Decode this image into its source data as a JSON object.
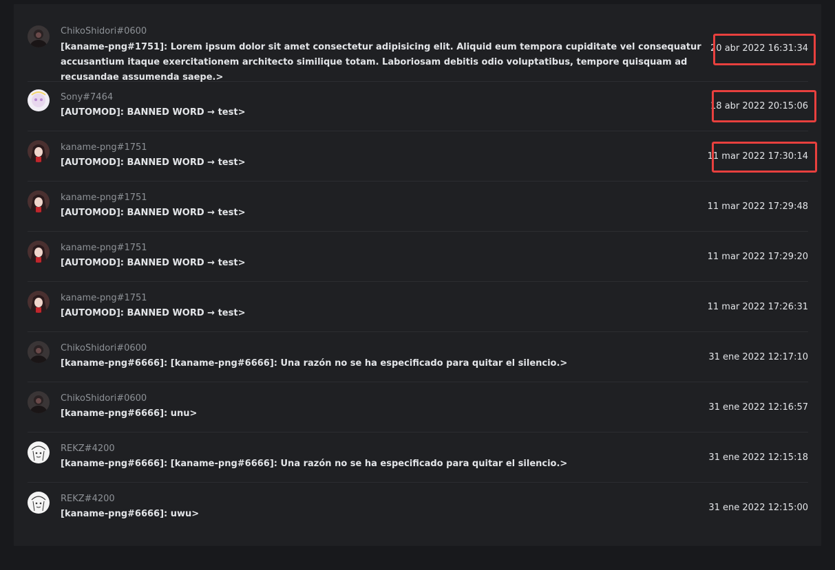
{
  "entries": [
    {
      "username": "ChikoShidori#0600",
      "message": "[kaname-png#1751]: Lorem ipsum dolor sit amet consectetur adipisicing elit. Aliquid eum tempora cupiditate vel consequatur accusantium itaque exercitationem architecto similique totam. Laboriosam debitis odio voluptatibus, tempore quisquam ad recusandae assumenda saepe.>",
      "timestamp": "20 abr 2022 16:31:34",
      "highlighted": true,
      "avatar": "dark-avatar-icon"
    },
    {
      "username": "Sony#7464",
      "message": "[AUTOMOD]: BANNED WORD → test>",
      "timestamp": "18 abr 2022 20:15:06",
      "highlighted": true,
      "avatar": "light-anime-avatar-icon"
    },
    {
      "username": "kaname-png#1751",
      "message": "[AUTOMOD]: BANNED WORD → test>",
      "timestamp": "11 mar 2022 17:30:14",
      "highlighted": true,
      "avatar": "anime-girl-avatar-icon"
    },
    {
      "username": "kaname-png#1751",
      "message": "[AUTOMOD]: BANNED WORD → test>",
      "timestamp": "11 mar 2022 17:29:48",
      "highlighted": false,
      "avatar": "anime-girl-avatar-icon"
    },
    {
      "username": "kaname-png#1751",
      "message": "[AUTOMOD]: BANNED WORD → test>",
      "timestamp": "11 mar 2022 17:29:20",
      "highlighted": false,
      "avatar": "anime-girl-avatar-icon"
    },
    {
      "username": "kaname-png#1751",
      "message": "[AUTOMOD]: BANNED WORD → test>",
      "timestamp": "11 mar 2022 17:26:31",
      "highlighted": false,
      "avatar": "anime-girl-avatar-icon"
    },
    {
      "username": "ChikoShidori#0600",
      "message": "[kaname-png#6666]: [kaname-png#6666]: Una razón no se ha especificado para quitar el silencio.>",
      "timestamp": "31 ene 2022 12:17:10",
      "highlighted": false,
      "avatar": "dark-avatar-icon"
    },
    {
      "username": "ChikoShidori#0600",
      "message": "[kaname-png#6666]: unu>",
      "timestamp": "31 ene 2022 12:16:57",
      "highlighted": false,
      "avatar": "dark-avatar-icon"
    },
    {
      "username": "REKZ#4200",
      "message": "[kaname-png#6666]: [kaname-png#6666]: Una razón no se ha especificado para quitar el silencio.>",
      "timestamp": "31 ene 2022 12:15:18",
      "highlighted": false,
      "avatar": "sketch-avatar-icon"
    },
    {
      "username": "REKZ#4200",
      "message": "[kaname-png#6666]: uwu>",
      "timestamp": "31 ene 2022 12:15:00",
      "highlighted": false,
      "avatar": "sketch-avatar-icon"
    }
  ],
  "colors": {
    "page_background": "#18191c",
    "panel_background": "#1f2023",
    "separator": "#2c2d31",
    "username": "#8e9297",
    "message": "#e3e5e8",
    "highlight_border": "#e8403e"
  }
}
